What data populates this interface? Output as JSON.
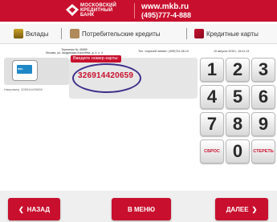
{
  "header": {
    "bank_line1": "МОСКОВСКИЙ",
    "bank_line2": "КРЕДИТНЫЙ",
    "bank_line3": "БАНК",
    "url": "www.mkb.ru",
    "phone": "(495)777-4-888"
  },
  "nav": {
    "deposits": "Вклады",
    "consumer_loans": "Потребительские кредиты",
    "credit_cards": "Кредитные карты"
  },
  "terminal": {
    "terminal_id": "Терминал № 45989",
    "address": "Москва, ул. Академика Королёва, д. 4, к. 4",
    "hotline": "Тел. «горячей линии»: (495)741-08-10",
    "datetime": "19 августа 2015 г. 15:41:13"
  },
  "side": {
    "card_icon": "card-icon",
    "card_text": "МКБ",
    "phone_label": "Например: 326914420659"
  },
  "input": {
    "label": "Введите номер карты:",
    "value": "326914420659"
  },
  "keypad": {
    "k1": "1",
    "k2": "2",
    "k3": "3",
    "k4": "4",
    "k5": "5",
    "k6": "6",
    "k7": "7",
    "k8": "8",
    "k9": "9",
    "k0": "0",
    "clear": "СБРОС",
    "erase": "СТЕРЕТЬ"
  },
  "footer": {
    "back": "НАЗАД",
    "menu": "В МЕНЮ",
    "next": "ДАЛЕЕ"
  },
  "colors": {
    "brand_red": "#c8102e",
    "highlight_circle": "#3c2f8a"
  }
}
